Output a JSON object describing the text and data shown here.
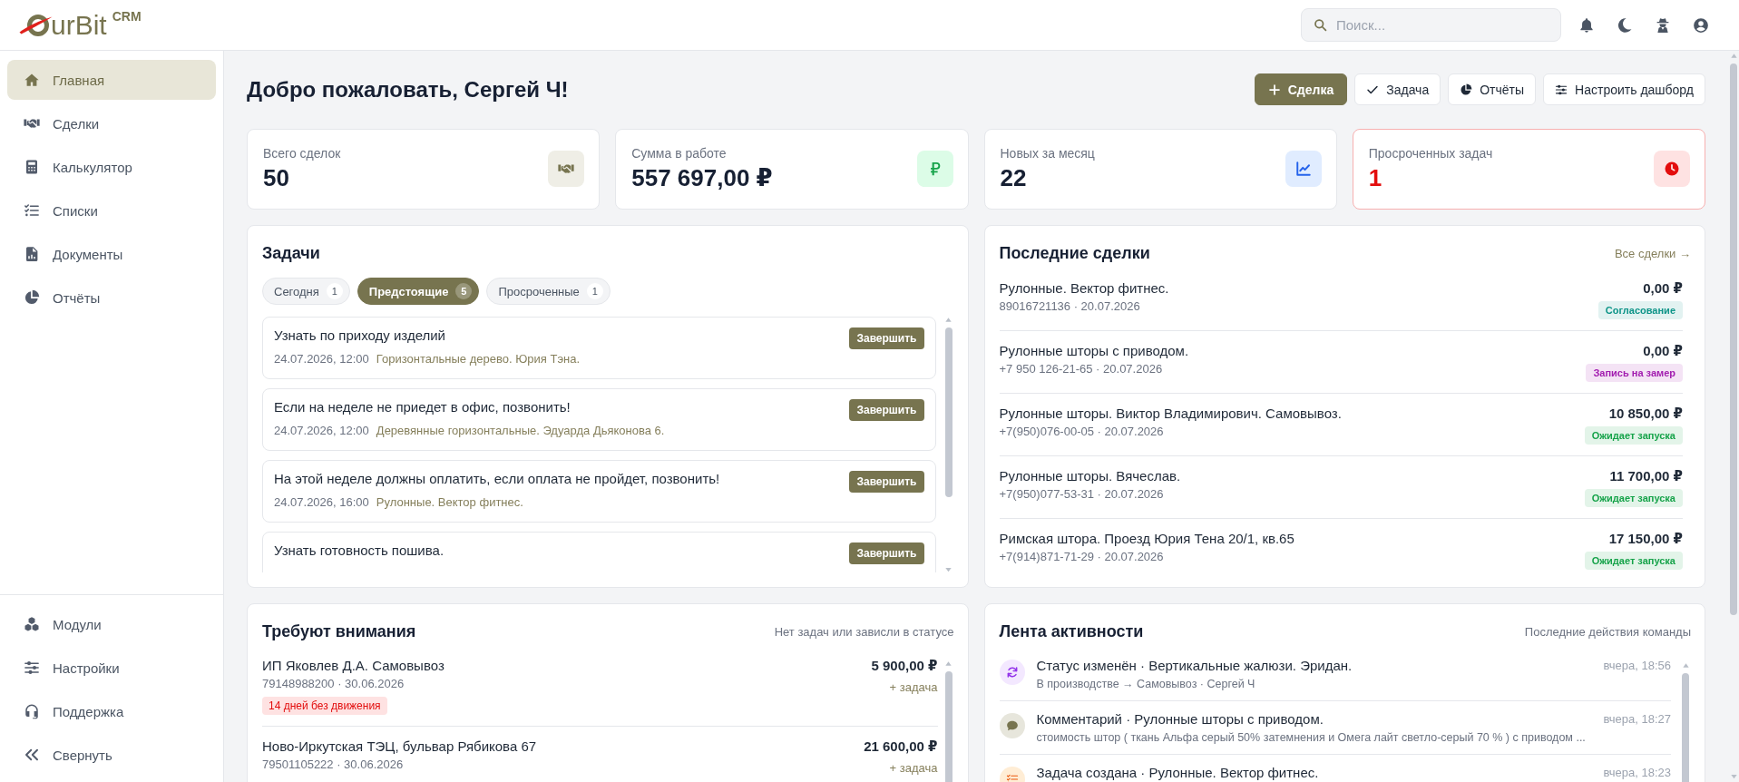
{
  "header": {
    "logo": {
      "text": "urBit",
      "suffix": "CRM"
    },
    "search": {
      "placeholder": "Поиск..."
    }
  },
  "sidebar": {
    "items": [
      {
        "label": "Главная",
        "selected": true
      },
      {
        "label": "Сделки",
        "selected": false
      },
      {
        "label": "Калькулятор",
        "selected": false
      },
      {
        "label": "Списки",
        "selected": false
      },
      {
        "label": "Документы",
        "selected": false
      },
      {
        "label": "Отчёты",
        "selected": false
      }
    ],
    "footer_items": [
      {
        "label": "Модули"
      },
      {
        "label": "Настройки"
      },
      {
        "label": "Поддержка"
      },
      {
        "label": "Свернуть"
      }
    ]
  },
  "page": {
    "title": "Добро пожаловать, Сергей Ч!",
    "actions": [
      {
        "label": "Сделка",
        "kind": "primary"
      },
      {
        "label": "Задача",
        "kind": "secondary"
      },
      {
        "label": "Отчёты",
        "kind": "secondary"
      },
      {
        "label": "Настроить дашборд",
        "kind": "secondary"
      }
    ]
  },
  "stats": [
    {
      "label": "Всего сделок",
      "value": "50",
      "alert": false
    },
    {
      "label": "Сумма в работе",
      "value": "557 697,00 ₽",
      "alert": false
    },
    {
      "label": "Новых за месяц",
      "value": "22",
      "alert": false
    },
    {
      "label": "Просроченных задач",
      "value": "1",
      "alert": true
    }
  ],
  "tasks": {
    "title": "Задачи",
    "tabs": [
      {
        "label": "Сегодня",
        "count": "1",
        "selected": false
      },
      {
        "label": "Предстоящие",
        "count": "5",
        "selected": true
      },
      {
        "label": "Просроченные",
        "count": "1",
        "selected": false
      }
    ],
    "items": [
      {
        "title": "Узнать по приходу изделий",
        "date": "24.07.2026, 12:00",
        "note": "Горизонтальные дерево. Юрия Тэна.",
        "action": "Завершить"
      },
      {
        "title": "Если на неделе не приедет в офис, позвонить!",
        "date": "24.07.2026, 12:00",
        "note": "Деревянные горизонтальные. Эдуарда Дьяконова 6.",
        "action": "Завершить"
      },
      {
        "title": "На этой неделе должны оплатить, если оплата не пройдет, позвонить!",
        "date": "24.07.2026, 16:00",
        "note": "Рулонные. Вектор фитнес.",
        "action": "Завершить"
      },
      {
        "title": "Узнать готовность пошива.",
        "action": "Завершить"
      }
    ]
  },
  "recent_deals": {
    "title": "Последние сделки",
    "link": "Все сделки →",
    "rows": [
      {
        "name": "Рулонные. Вектор фитнес.",
        "contact": "89016721136 · 20.07.2026",
        "amount": "0,00 ₽",
        "status": "Согласование",
        "color": "#0d9488"
      },
      {
        "name": "Рулонные шторы с приводом.",
        "contact": "+7 950 126-21-65 · 20.07.2026",
        "amount": "0,00 ₽",
        "status": "Запись на замер",
        "color": "#a21caf"
      },
      {
        "name": "Рулонные шторы. Виктор Владимирович. Самовывоз.",
        "contact": "+7(950)076-00-05 · 20.07.2026",
        "amount": "10 850,00 ₽",
        "status": "Ожидает запуска",
        "color": "#16a34a"
      },
      {
        "name": "Рулонные шторы. Вячеслав.",
        "contact": "+7(950)077-53-31 · 20.07.2026",
        "amount": "11 700,00 ₽",
        "status": "Ожидает запуска",
        "color": "#16a34a"
      },
      {
        "name": "Римская штора. Проезд Юрия Тена 20/1, кв.65",
        "contact": "+7(914)871-71-29 · 20.07.2026",
        "amount": "17 150,00 ₽",
        "status": "Ожидает запуска",
        "color": "#16a34a"
      }
    ]
  },
  "attention": {
    "title": "Требуют внимания",
    "hint": "Нет задач или зависли в статусе",
    "rows": [
      {
        "name": "ИП Яковлев Д.А. Самовывоз",
        "contact": "79148988200 · 30.06.2026",
        "amount": "5 900,00 ₽",
        "action": "+ задача",
        "flag": "14 дней без движения"
      },
      {
        "name": "Ново-Иркутская ТЭЦ, бульвар Рябикова 67",
        "contact": "79501105222 · 30.06.2026",
        "amount": "21 600,00 ₽",
        "action": "+ задача"
      }
    ]
  },
  "activity": {
    "title": "Лента активности",
    "hint": "Последние действия команды",
    "items": [
      {
        "kind": "status",
        "title": "Статус изменён · Вертикальные жалюзи. Эридан.",
        "detail": "В производстве → Самовывоз · Сергей Ч",
        "time": "вчера, 18:56"
      },
      {
        "kind": "comment",
        "title": "Комментарий · Рулонные шторы с приводом.",
        "detail": "стоимость штор ( ткань Альфа серый 50% затемнения и Омега лайт светло-серый 70 % ) с приводом ...",
        "time": "вчера, 18:27"
      },
      {
        "kind": "task",
        "title": "Задача создана · Рулонные. Вектор фитнес.",
        "time": "вчера, 18:23"
      }
    ]
  }
}
